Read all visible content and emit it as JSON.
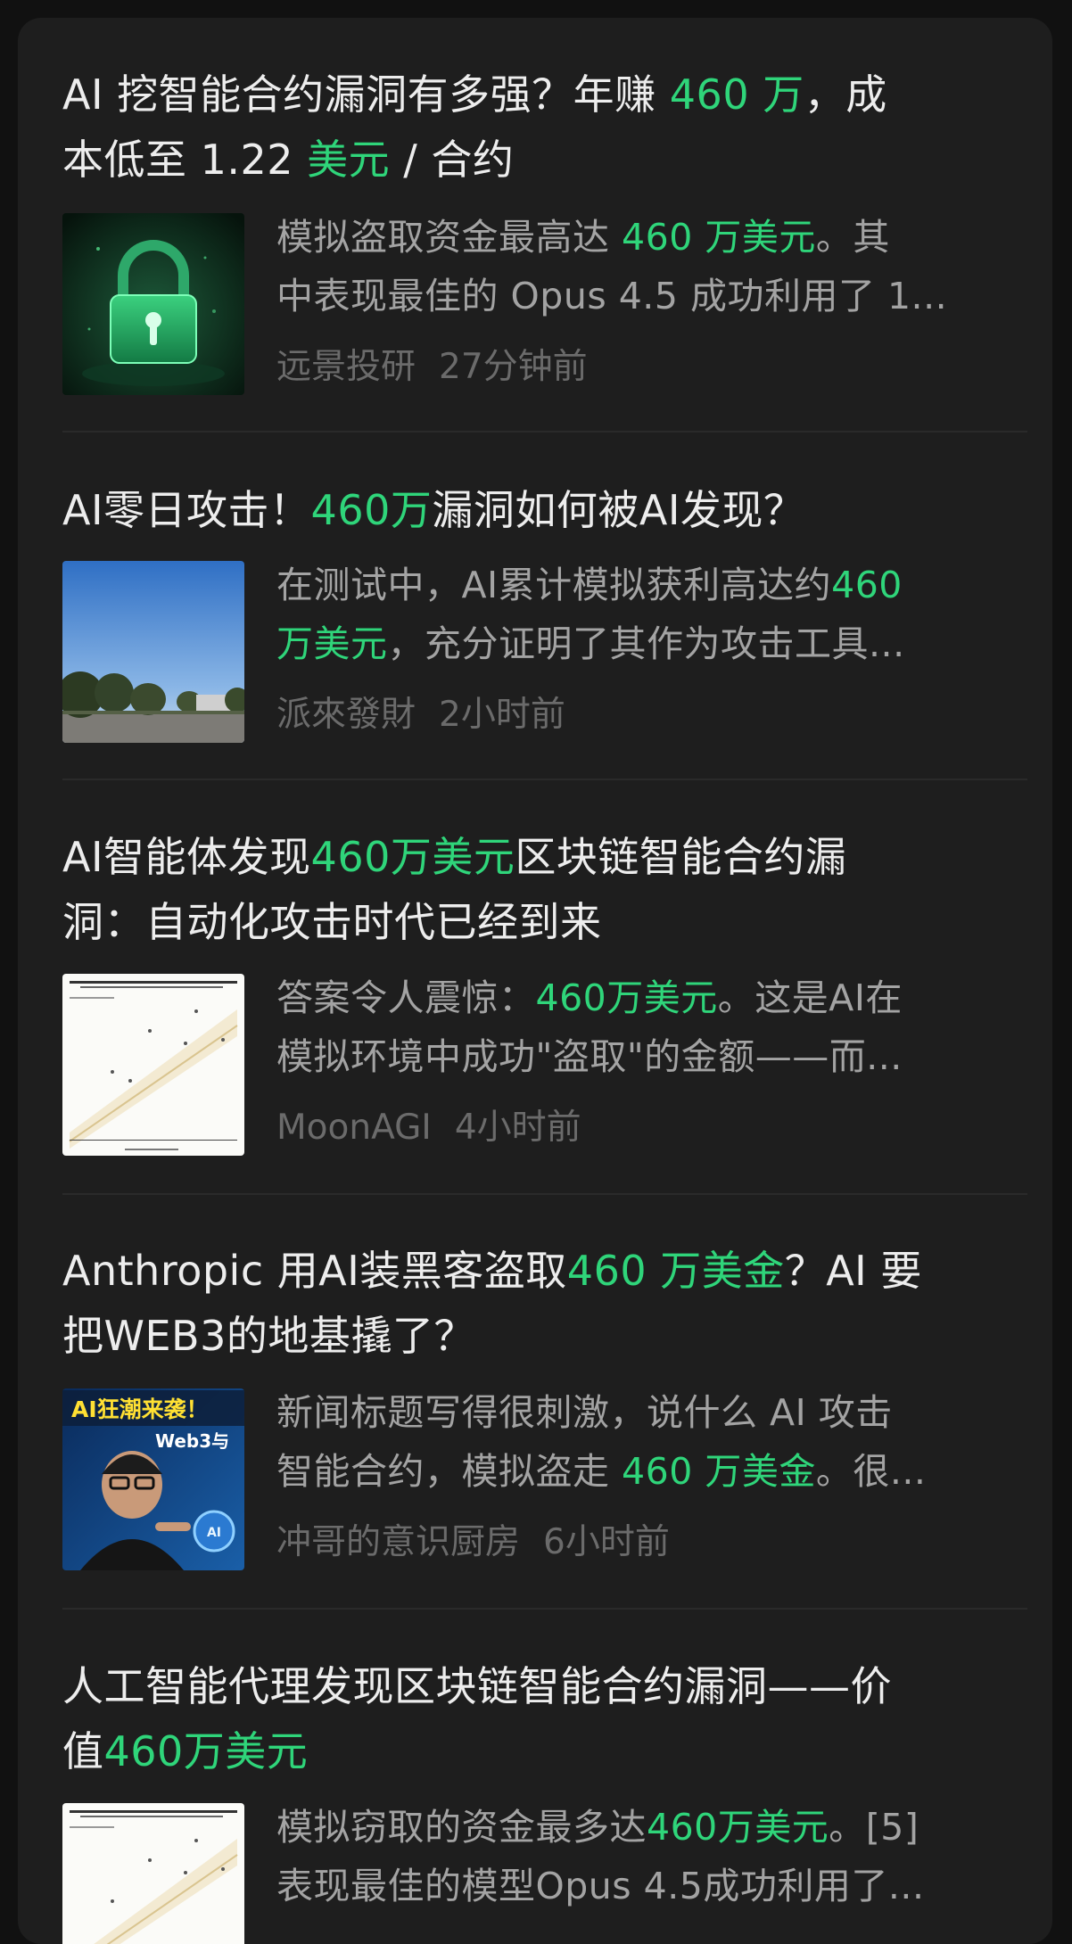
{
  "colors": {
    "background": "#111111",
    "card": "#1e1e1e",
    "title_text": "#ededed",
    "highlight": "#2fd57a",
    "snippet_text": "#a3a3a3",
    "meta_text": "#6b6b6b"
  },
  "articles": [
    {
      "title_lines": [
        [
          {
            "t": "AI 挖智能合约漏洞有多强？年赚 ",
            "h": false
          },
          {
            "t": "460 万",
            "h": true
          },
          {
            "t": "，成",
            "h": false
          }
        ],
        [
          {
            "t": "本低至 1.22 ",
            "h": false
          },
          {
            "t": "美元",
            "h": true
          },
          {
            "t": " / 合约",
            "h": false
          }
        ]
      ],
      "snippet_lines": [
        [
          {
            "t": "模拟盗取资金最高达 ",
            "h": false
          },
          {
            "t": "460 万美元",
            "h": true
          },
          {
            "t": "。其",
            "h": false
          }
        ],
        [
          {
            "t": "中表现最佳的 Opus 4.5 成功利用了 1...",
            "h": false
          }
        ]
      ],
      "source": "远景投研",
      "time": "27分钟前",
      "thumbnail": "green-padlock-image"
    },
    {
      "title_lines": [
        [
          {
            "t": "AI零日攻击！",
            "h": false
          },
          {
            "t": "460万",
            "h": true
          },
          {
            "t": "漏洞如何被AI发现？",
            "h": false
          }
        ]
      ],
      "snippet_lines": [
        [
          {
            "t": "在测试中，AI累计模拟获利高达约",
            "h": false
          },
          {
            "t": "460",
            "h": true
          }
        ],
        [
          {
            "t": "万美元",
            "h": true
          },
          {
            "t": "，充分证明了其作为攻击工具...",
            "h": false
          }
        ]
      ],
      "source": "派來發財",
      "time": "2小时前",
      "thumbnail": "sky-trees-photo"
    },
    {
      "title_lines": [
        [
          {
            "t": "AI智能体发现",
            "h": false
          },
          {
            "t": "460万美元",
            "h": true
          },
          {
            "t": "区块链智能合约漏",
            "h": false
          }
        ],
        [
          {
            "t": "洞：自动化攻击时代已经到来",
            "h": false
          }
        ]
      ],
      "snippet_lines": [
        [
          {
            "t": "答案令人震惊：",
            "h": false
          },
          {
            "t": "460万美元",
            "h": true
          },
          {
            "t": "。这是AI在",
            "h": false
          }
        ],
        [
          {
            "t": "模拟环境中成功\"盗取\"的金额——而...",
            "h": false
          }
        ]
      ],
      "source": "MoonAGI",
      "time": "4小时前",
      "thumbnail": "revenue-chart-image"
    },
    {
      "title_lines": [
        [
          {
            "t": "Anthropic 用AI装黑客盗取",
            "h": false
          },
          {
            "t": "460 万美金",
            "h": true
          },
          {
            "t": "？AI 要",
            "h": false
          }
        ],
        [
          {
            "t": "把WEB3的地基撬了？",
            "h": false
          }
        ]
      ],
      "snippet_lines": [
        [
          {
            "t": "新闻标题写得很刺激，说什么 AI 攻击",
            "h": false
          }
        ],
        [
          {
            "t": "智能合约，模拟盗走 ",
            "h": false
          },
          {
            "t": "460 万美金",
            "h": true
          },
          {
            "t": "。很...",
            "h": false
          }
        ]
      ],
      "source": "冲哥的意识厨房",
      "time": "6小时前",
      "thumbnail": "video-cover-image",
      "thumbnail_text": [
        "AI狂潮来袭！",
        "Web3与",
        "AI"
      ]
    },
    {
      "title_lines": [
        [
          {
            "t": "人工智能代理发现区块链智能合约漏洞——价",
            "h": false
          }
        ],
        [
          {
            "t": "值",
            "h": false
          },
          {
            "t": "460万美元",
            "h": true
          }
        ]
      ],
      "snippet_lines": [
        [
          {
            "t": "模拟窃取的资金最多达",
            "h": false
          },
          {
            "t": "460万美元",
            "h": true
          },
          {
            "t": "。[5]",
            "h": false
          }
        ],
        [
          {
            "t": "表现最佳的模型Opus 4.5成功利用了...",
            "h": false
          }
        ]
      ],
      "thumbnail": "revenue-chart-image"
    }
  ]
}
